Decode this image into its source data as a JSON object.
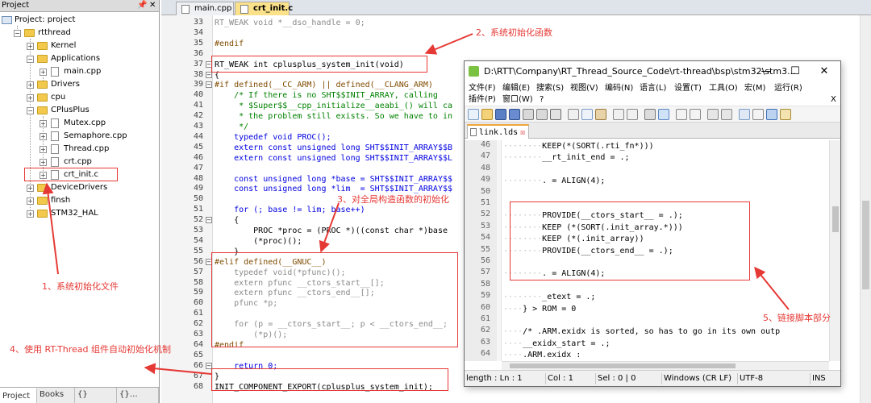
{
  "project": {
    "header": "Project",
    "pin": "📌",
    "close": "✕",
    "root": "Project: project",
    "group": "rtthread",
    "folders": {
      "kernel": "Kernel",
      "applications": "Applications",
      "drivers": "Drivers",
      "cpu": "cpu",
      "cplusplus": "CPlusPlus",
      "devicedrivers": "DeviceDrivers",
      "finsh": "finsh",
      "stm32hal": "STM32_HAL"
    },
    "files": {
      "main": "main.cpp",
      "mutex": "Mutex.cpp",
      "semaphore": "Semaphore.cpp",
      "thread": "Thread.cpp",
      "crt": "crt.cpp",
      "crtinit": "crt_init.c"
    },
    "tabs": [
      "Project",
      "Books",
      "{} Funct...",
      "{}… Templ..."
    ]
  },
  "editor": {
    "tabs": [
      "main.cpp",
      "crt_init.c"
    ],
    "lines": [
      {
        "n": "33",
        "t": "RT_WEAK void *__dso_handle = 0;",
        "c": "gray"
      },
      {
        "n": "34",
        "t": "",
        "c": ""
      },
      {
        "n": "35",
        "t": "#endif",
        "c": "pp"
      },
      {
        "n": "36",
        "t": "",
        "c": ""
      },
      {
        "n": "37",
        "t": "RT_WEAK int cplusplus_system_init(void)",
        "c": ""
      },
      {
        "n": "38",
        "t": "{",
        "c": ""
      },
      {
        "n": "39",
        "t": "#if defined(__CC_ARM) || defined(__CLANG_ARM)",
        "c": "pp"
      },
      {
        "n": "40",
        "t": "    /* If there is no SHT$$INIT_ARRAY, calling",
        "c": "cm"
      },
      {
        "n": "41",
        "t": "     * $Super$$__cpp_initialize__aeabi_() will ca",
        "c": "cm"
      },
      {
        "n": "42",
        "t": "     * the problem still exists. So we have to in",
        "c": "cm"
      },
      {
        "n": "43",
        "t": "     */",
        "c": "cm"
      },
      {
        "n": "44",
        "t": "    typedef void PROC();",
        "c": "kw"
      },
      {
        "n": "45",
        "t": "    extern const unsigned long SHT$$INIT_ARRAY$$B",
        "c": "kw"
      },
      {
        "n": "46",
        "t": "    extern const unsigned long SHT$$INIT_ARRAY$$L",
        "c": "kw"
      },
      {
        "n": "47",
        "t": "",
        "c": ""
      },
      {
        "n": "48",
        "t": "    const unsigned long *base = SHT$$INIT_ARRAY$$",
        "c": "kw"
      },
      {
        "n": "49",
        "t": "    const unsigned long *lim  = SHT$$INIT_ARRAY$$",
        "c": "kw"
      },
      {
        "n": "50",
        "t": "",
        "c": ""
      },
      {
        "n": "51",
        "t": "    for (; base != lim; base++)",
        "c": "kw"
      },
      {
        "n": "52",
        "t": "    {",
        "c": ""
      },
      {
        "n": "53",
        "t": "        PROC *proc = (PROC *)((const char *)base",
        "c": ""
      },
      {
        "n": "54",
        "t": "        (*proc)();",
        "c": ""
      },
      {
        "n": "55",
        "t": "    }",
        "c": ""
      },
      {
        "n": "56",
        "t": "#elif defined(__GNUC__)",
        "c": "pp"
      },
      {
        "n": "57",
        "t": "    typedef void(*pfunc)();",
        "c": "gray"
      },
      {
        "n": "58",
        "t": "    extern pfunc __ctors_start__[];",
        "c": "gray"
      },
      {
        "n": "59",
        "t": "    extern pfunc __ctors_end__[];",
        "c": "gray"
      },
      {
        "n": "60",
        "t": "    pfunc *p;",
        "c": "gray"
      },
      {
        "n": "61",
        "t": "",
        "c": ""
      },
      {
        "n": "62",
        "t": "    for (p = __ctors_start__; p < __ctors_end__; ",
        "c": "gray"
      },
      {
        "n": "63",
        "t": "        (*p)();",
        "c": "gray"
      },
      {
        "n": "64",
        "t": "#endif",
        "c": "pp"
      },
      {
        "n": "65",
        "t": "",
        "c": ""
      },
      {
        "n": "66",
        "t": "    return 0;",
        "c": "kw"
      },
      {
        "n": "67",
        "t": "}",
        "c": ""
      },
      {
        "n": "68",
        "t": "INIT_COMPONENT_EXPORT(cplusplus_system_init);",
        "c": ""
      }
    ]
  },
  "npp": {
    "title": "D:\\RTT\\Company\\RT_Thread_Source_Code\\rt-thread\\bsp\\stm32\\stm3...",
    "win_min": "—",
    "win_max": "☐",
    "win_close": "✕",
    "menu_close": "X",
    "menu": [
      "文件(F)",
      "编辑(E)",
      "搜索(S)",
      "视图(V)",
      "编码(N)",
      "语言(L)",
      "设置(T)",
      "工具(O)",
      "宏(M)",
      "运行(R)",
      "插件(P)",
      "窗口(W)",
      "?"
    ],
    "tab": "link.lds",
    "tab_close": "☒",
    "lines": [
      {
        "n": "46",
        "d": "········",
        "t": "KEEP(*(SORT(.rti_fn*)))"
      },
      {
        "n": "47",
        "d": "········",
        "t": "__rt_init_end = .;"
      },
      {
        "n": "48",
        "d": "",
        "t": ""
      },
      {
        "n": "49",
        "d": "········",
        "t": ". = ALIGN(4);"
      },
      {
        "n": "50",
        "d": "",
        "t": ""
      },
      {
        "n": "51",
        "d": "",
        "t": ""
      },
      {
        "n": "52",
        "d": "········",
        "t": "PROVIDE(__ctors_start__ = .);"
      },
      {
        "n": "53",
        "d": "········",
        "t": "KEEP (*(SORT(.init_array.*)))"
      },
      {
        "n": "54",
        "d": "········",
        "t": "KEEP (*(.init_array))"
      },
      {
        "n": "55",
        "d": "········",
        "t": "PROVIDE(__ctors_end__ = .);"
      },
      {
        "n": "56",
        "d": "",
        "t": ""
      },
      {
        "n": "57",
        "d": "········",
        "t": ". = ALIGN(4);"
      },
      {
        "n": "58",
        "d": "",
        "t": ""
      },
      {
        "n": "59",
        "d": "········",
        "t": "_etext = .;"
      },
      {
        "n": "60",
        "d": "····",
        "t": "} > ROM = 0"
      },
      {
        "n": "61",
        "d": "",
        "t": ""
      },
      {
        "n": "62",
        "d": "····",
        "t": "/* .ARM.exidx is sorted, so has to go in its own outp"
      },
      {
        "n": "63",
        "d": "····",
        "t": "__exidx_start = .;"
      },
      {
        "n": "64",
        "d": "····",
        "t": ".ARM.exidx :"
      }
    ],
    "status": {
      "length": "length : Ln : 1",
      "col": "Col : 1",
      "sel": "Sel : 0 | 0",
      "eol": "Windows (CR LF)",
      "enc": "UTF-8",
      "ins": "INS"
    }
  },
  "annotations": {
    "a1": "1、系统初始化文件",
    "a2": "2、系统初始化函数",
    "a3": "3、对全局构造函数的初始化",
    "a4": "4、使用 RT-Thread 组件自动初始化机制",
    "a5": "5、链接脚本部分",
    "color": "#e53935"
  }
}
